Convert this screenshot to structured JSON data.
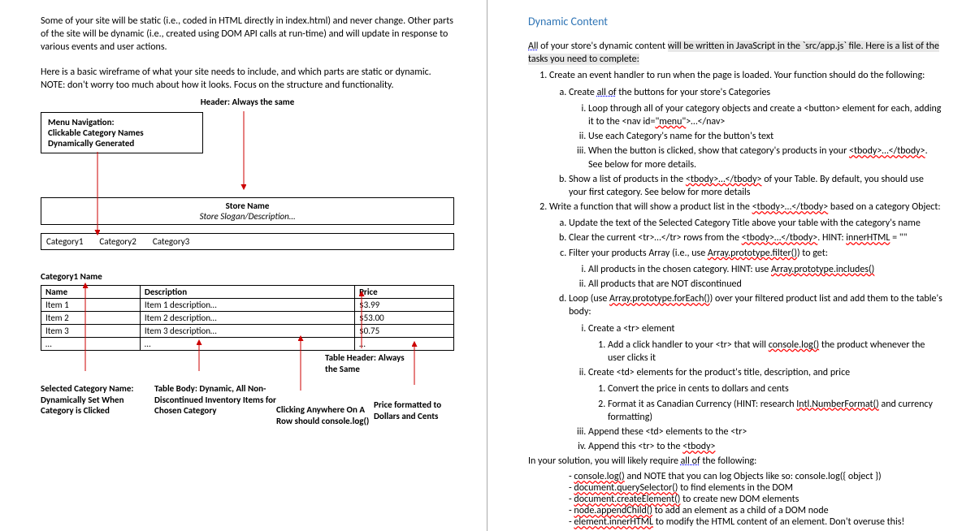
{
  "left": {
    "intro1": "Some of your site will be static (i.e., coded in HTML directly in index.html) and never change. Other parts of the site will be dynamic (i.e., created using DOM API calls at run-time) and will update in response to various events and user actions.",
    "intro2": "Here is a basic wireframe of what your site needs to include, and which parts are static or dynamic.  NOTE: don't worry too much about how it looks.  Focus on the structure and functionality.",
    "wf": {
      "header_note": "Header: Always the same",
      "nav_annot_l1": "Menu Navigation:",
      "nav_annot_l2": "Clickable Category Names",
      "nav_annot_l3": "Dynamically Generated",
      "store_name": "Store Name",
      "store_slogan": "Store Slogan/Description…",
      "cat1": "Category1",
      "cat2": "Category2",
      "cat3": "Category3",
      "cat_title": "Category1 Name",
      "th_name": "Name",
      "th_desc": "Description",
      "th_price": "Price",
      "r1_name": "Item 1",
      "r1_desc": "Item 1 description…",
      "r1_price": "$3.99",
      "r2_name": "Item 2",
      "r2_desc": "Item 2 description…",
      "r2_price": "$53.00",
      "r3_name": "Item 3",
      "r3_desc": "Item 3 description…",
      "r3_price": "$0.75",
      "dots": "…",
      "ann_sel": "Selected Category Name: Dynamically Set When Category is Clicked",
      "ann_body": "Table Body: Dynamic, All Non-Discontinued Inventory Items for Chosen Category",
      "ann_header": "Table Header: Always the Same",
      "ann_row": "Clicking Anywhere On A Row should console.log()",
      "ann_price": "Price formatted to Dollars and Cents"
    }
  },
  "right": {
    "heading": "Dynamic Content",
    "intro_a": "All",
    "intro_b": " of your store's dynamic content ",
    "intro_hl": "will be written in JavaScript in the `src/app.js` file.  Here is a list of the tasks you need to complete:",
    "l1": "Create an event handler to run when the page is loaded.  Your function should do the following:",
    "l1a_pre": "Create ",
    "l1a_u": "all of",
    "l1a_post": " the buttons for your store's Categories",
    "l1a_i": "Loop through all of your category objects and create a <button> element for each, adding it to the <nav id=",
    "l1a_i_q": "\"menu\"",
    "l1a_i_end": ">…</nav>",
    "l1a_ii": "Use each Category's name for the button's text",
    "l1a_iii_pre": "When the button is clicked, show that category's products in your ",
    "l1a_iii_code": "<tbody>…</tbody>",
    "l1a_iii_post": ".  See below for more details.",
    "l1b_pre": "Show a list of products in the ",
    "l1b_code": "<tbody>…</tbody>",
    "l1b_post": " of your Table.  By default, you should use your first category.  See below for more details",
    "l2_pre": "Write a function that will show a product list in the ",
    "l2_code": "<tbody>…</tbody>",
    "l2_post": " based on a category Object:",
    "l2a": "Update the text of the Selected Category Title above your table with the category's name",
    "l2b_pre": "Clear the current <tr>…</tr> rows from the ",
    "l2b_code": "<tbody>…</tbody>",
    "l2b_post": ". HINT: ",
    "l2b_hint": "innerHTML",
    "l2b_eq": " = \"\"",
    "l2c_pre": "Filter your products Array (i.e., use ",
    "l2c_fn": "Array.prototype.filter()",
    "l2c_post": ") to get:",
    "l2c_i_pre": "All products in the chosen category. HINT: use ",
    "l2c_i_fn": "Array.prototype.includes()",
    "l2c_ii": "All products that are NOT discontinued",
    "l2d_pre": "Loop (use ",
    "l2d_fn": "Array.prototype.forEach()",
    "l2d_post": ") over your filtered product list and add them to the table's body:",
    "l2d_i": "Create a <tr> element",
    "l2d_i_1_pre": "Add a click handler to your <tr> that will ",
    "l2d_i_1_fn": "console.log()",
    "l2d_i_1_post": " the product whenever the user clicks it",
    "l2d_ii": "Create <td> elements for the product's title, description, and price",
    "l2d_ii_1": "Convert the price in cents to dollars and cents",
    "l2d_ii_2_pre": "Format it as Canadian Currency (HINT: research ",
    "l2d_ii_2_fn": "Intl.NumberFormat()",
    "l2d_ii_2_post": " and currency formatting)",
    "l2d_iii": "Append these <td> elements to the <tr>",
    "l2d_iv_pre": "Append this <tr> to the ",
    "l2d_iv_code": "<tbody>",
    "mid_pre": "In your solution, you will likely require ",
    "mid_u": "all of",
    "mid_post": " the following:",
    "b1_fn": "console.log()",
    "b1_post": " and NOTE that you can log Objects like so: console.log({ object })",
    "b2_fn": "document.querySelector()",
    "b2_post": " to find elements in the DOM",
    "b3_fn": "document.createElement()",
    "b3_post": " to create new DOM elements",
    "b4_fn": "node.appendChild()",
    "b4_post": " to add an element as a child of a DOM node",
    "b5_fn": "element.innerHTML",
    "b5_post": " to modify the HTML content of an element.  Don't overuse this!"
  }
}
